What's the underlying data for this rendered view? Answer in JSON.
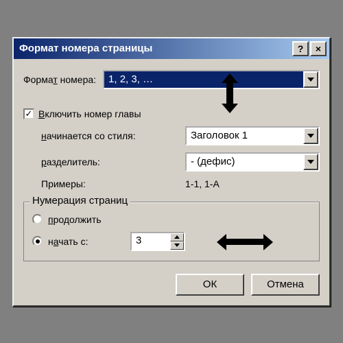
{
  "window": {
    "title": "Формат номера страницы",
    "help_glyph": "?",
    "close_glyph": "×"
  },
  "format": {
    "label_pre": "Форма",
    "label_und": "т",
    "label_post": " номера:",
    "value": "1, 2, 3, …"
  },
  "include_chapter": {
    "checked": "✓",
    "label_und": "В",
    "label_post": "ключить номер главы"
  },
  "starts_style": {
    "label_und": "н",
    "label_post": "ачинается со стиля:",
    "value": "Заголовок 1"
  },
  "separator": {
    "label_und": "р",
    "label_post": "азделитель:",
    "value": "-   (дефис)"
  },
  "examples": {
    "label": "Примеры:",
    "value": "1-1, 1-A"
  },
  "numbering_group": {
    "legend": "Нумерация страниц",
    "continue": {
      "label_und": "п",
      "label_post": "родолжить"
    },
    "start_at": {
      "label_pre": "н",
      "label_und": "а",
      "label_post": "чать с:",
      "value": "3"
    }
  },
  "buttons": {
    "ok": "ОК",
    "cancel": "Отмена"
  }
}
